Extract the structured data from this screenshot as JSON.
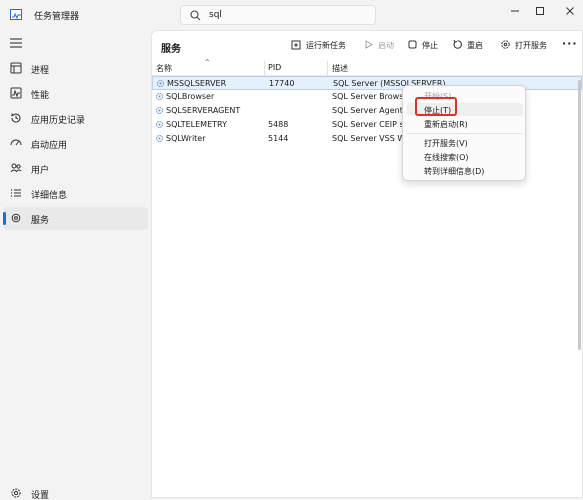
{
  "window": {
    "title": "任务管理器",
    "search_value": "sql",
    "controls": [
      "minimize-icon",
      "maximize-icon",
      "close-icon"
    ]
  },
  "nav": {
    "items": [
      {
        "label": "进程",
        "icon": "processes-icon"
      },
      {
        "label": "性能",
        "icon": "performance-icon"
      },
      {
        "label": "应用历史记录",
        "icon": "app-history-icon"
      },
      {
        "label": "启动应用",
        "icon": "startup-icon"
      },
      {
        "label": "用户",
        "icon": "users-icon"
      },
      {
        "label": "详细信息",
        "icon": "details-icon"
      },
      {
        "label": "服务",
        "icon": "services-icon",
        "active": true
      }
    ],
    "settings_label": "设置"
  },
  "page": {
    "title": "服务",
    "toolbar": {
      "run_new_task": "运行新任务",
      "start": "启动",
      "stop": "停止",
      "restart": "重启",
      "open_services": "打开服务",
      "more": "···"
    }
  },
  "table": {
    "columns": [
      "名称",
      "PID",
      "描述"
    ],
    "rows": [
      {
        "name": "MSSQLSERVER",
        "pid": "17740",
        "desc": "SQL Server (MSSQLSERVER)",
        "selected": true
      },
      {
        "name": "SQLBrowser",
        "pid": "",
        "desc": "SQL Server Browser"
      },
      {
        "name": "SQLSERVERAGENT",
        "pid": "",
        "desc": "SQL Server Agent (MSSQLSERVER)"
      },
      {
        "name": "SQLTELEMETRY",
        "pid": "5488",
        "desc": "SQL Server CEIP service (MSSQLSERVER)"
      },
      {
        "name": "SQLWriter",
        "pid": "5144",
        "desc": "SQL Server VSS Writer"
      }
    ]
  },
  "context_menu": {
    "items": [
      {
        "label": "开始(S)",
        "disabled": true
      },
      {
        "label": "停止(T)",
        "highlighted": true
      },
      {
        "label": "重新启动(R)"
      },
      {
        "label": "打开服务(V)"
      },
      {
        "label": "在线搜索(O)"
      },
      {
        "label": "转到详细信息(D)"
      }
    ]
  },
  "colors": {
    "accent": "#1b6fc7",
    "highlight_border": "#d9342b",
    "selected_row": "#e6f0fb"
  }
}
